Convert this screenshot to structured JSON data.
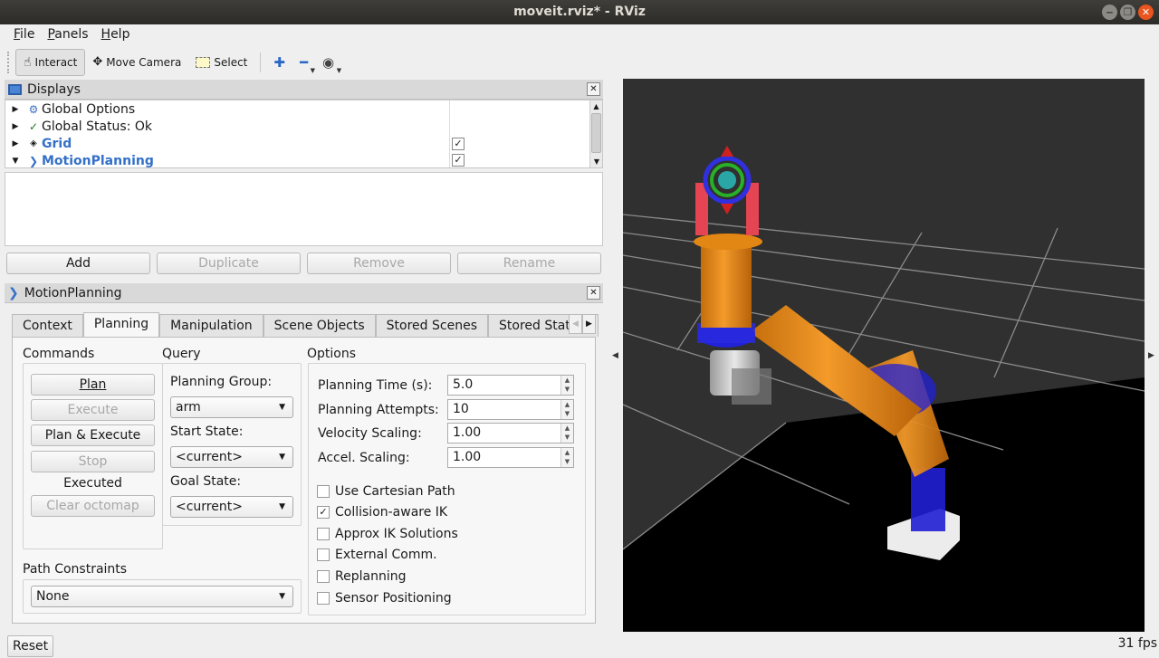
{
  "window": {
    "title": "moveit.rviz* - RViz",
    "buttons": [
      "‒",
      "❐",
      "✕"
    ]
  },
  "menu": [
    "File",
    "Panels",
    "Help"
  ],
  "toolbar": {
    "interact": "Interact",
    "move_camera": "Move Camera",
    "select": "Select"
  },
  "displays": {
    "title": "Displays",
    "items": [
      {
        "label": "Global Options",
        "icon": "gear-icon",
        "expanded": false
      },
      {
        "label": "Global Status: Ok",
        "icon": "check-icon",
        "expanded": false
      },
      {
        "label": "Grid",
        "icon": "grid-icon",
        "expanded": false,
        "checked": true
      },
      {
        "label": "MotionPlanning",
        "icon": "motion-planning-icon",
        "expanded": true,
        "checked": true
      }
    ],
    "buttons": {
      "add": "Add",
      "duplicate": "Duplicate",
      "remove": "Remove",
      "rename": "Rename"
    }
  },
  "motion": {
    "title": "MotionPlanning",
    "tabs": [
      "Context",
      "Planning",
      "Manipulation",
      "Scene Objects",
      "Stored Scenes",
      "Stored States"
    ],
    "active_tab": "Planning",
    "commands": {
      "title": "Commands",
      "plan": "Plan",
      "execute": "Execute",
      "plan_execute": "Plan & Execute",
      "stop": "Stop",
      "status": "Executed",
      "clear_octomap": "Clear octomap"
    },
    "query": {
      "title": "Query",
      "planning_group_label": "Planning Group:",
      "planning_group": "arm",
      "start_state_label": "Start State:",
      "start_state": "<current>",
      "goal_state_label": "Goal State:",
      "goal_state": "<current>"
    },
    "options": {
      "title": "Options",
      "planning_time_label": "Planning Time (s):",
      "planning_time": "5.0",
      "planning_attempts_label": "Planning Attempts:",
      "planning_attempts": "10",
      "velocity_scaling_label": "Velocity Scaling:",
      "velocity_scaling": "1.00",
      "accel_scaling_label": "Accel. Scaling:",
      "accel_scaling": "1.00",
      "checkboxes": [
        {
          "label": "Use Cartesian Path",
          "checked": false
        },
        {
          "label": "Collision-aware IK",
          "checked": true
        },
        {
          "label": "Approx IK Solutions",
          "checked": false
        },
        {
          "label": "External Comm.",
          "checked": false
        },
        {
          "label": "Replanning",
          "checked": false
        },
        {
          "label": "Sensor Positioning",
          "checked": false
        }
      ]
    },
    "path_constraints": {
      "label": "Path Constraints",
      "value": "None"
    }
  },
  "status": {
    "reset": "Reset",
    "fps": "31 fps"
  },
  "colors": {
    "accent_blue": "#3370c8",
    "viewport_bg": "#2f2f2f",
    "robot_orange": "#e98a1f",
    "robot_blue": "#2a2adf",
    "close_btn": "#e9541f"
  }
}
